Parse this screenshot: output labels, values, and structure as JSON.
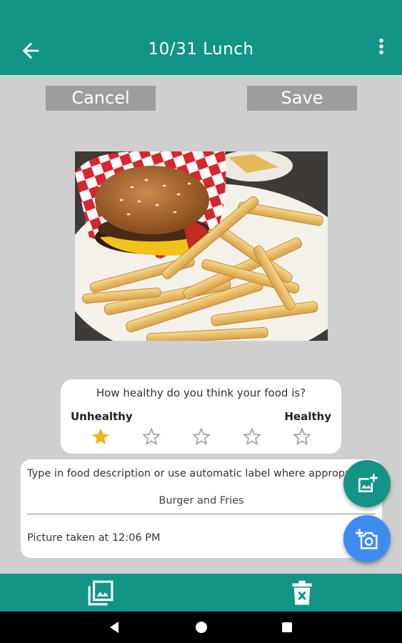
{
  "header": {
    "title": "10/31 Lunch"
  },
  "actions": {
    "cancel_label": "Cancel",
    "save_label": "Save"
  },
  "photo": {
    "subject": "burger-and-fries-photo"
  },
  "rating": {
    "question": "How healthy do you think your food is?",
    "low_label": "Unhealthy",
    "high_label": "Healthy",
    "value": 1,
    "max": 5,
    "filled_color": "#f2b51b",
    "empty_color": "#9e9e9e"
  },
  "description": {
    "prompt": "Type in food description or use automatic label where appropriate",
    "value": "Burger and Fries",
    "picture_time": "Picture taken at 12:06 PM"
  },
  "colors": {
    "primary": "#129586",
    "camera_fab": "#3f8cf0",
    "background": "#cfcfcf"
  },
  "icons": {
    "back": "arrow-left-icon",
    "more": "more-vertical-icon",
    "add_photo": "add-photo-icon",
    "add_camera": "add-camera-icon",
    "gallery": "photo-library-icon",
    "delete": "delete-icon"
  }
}
